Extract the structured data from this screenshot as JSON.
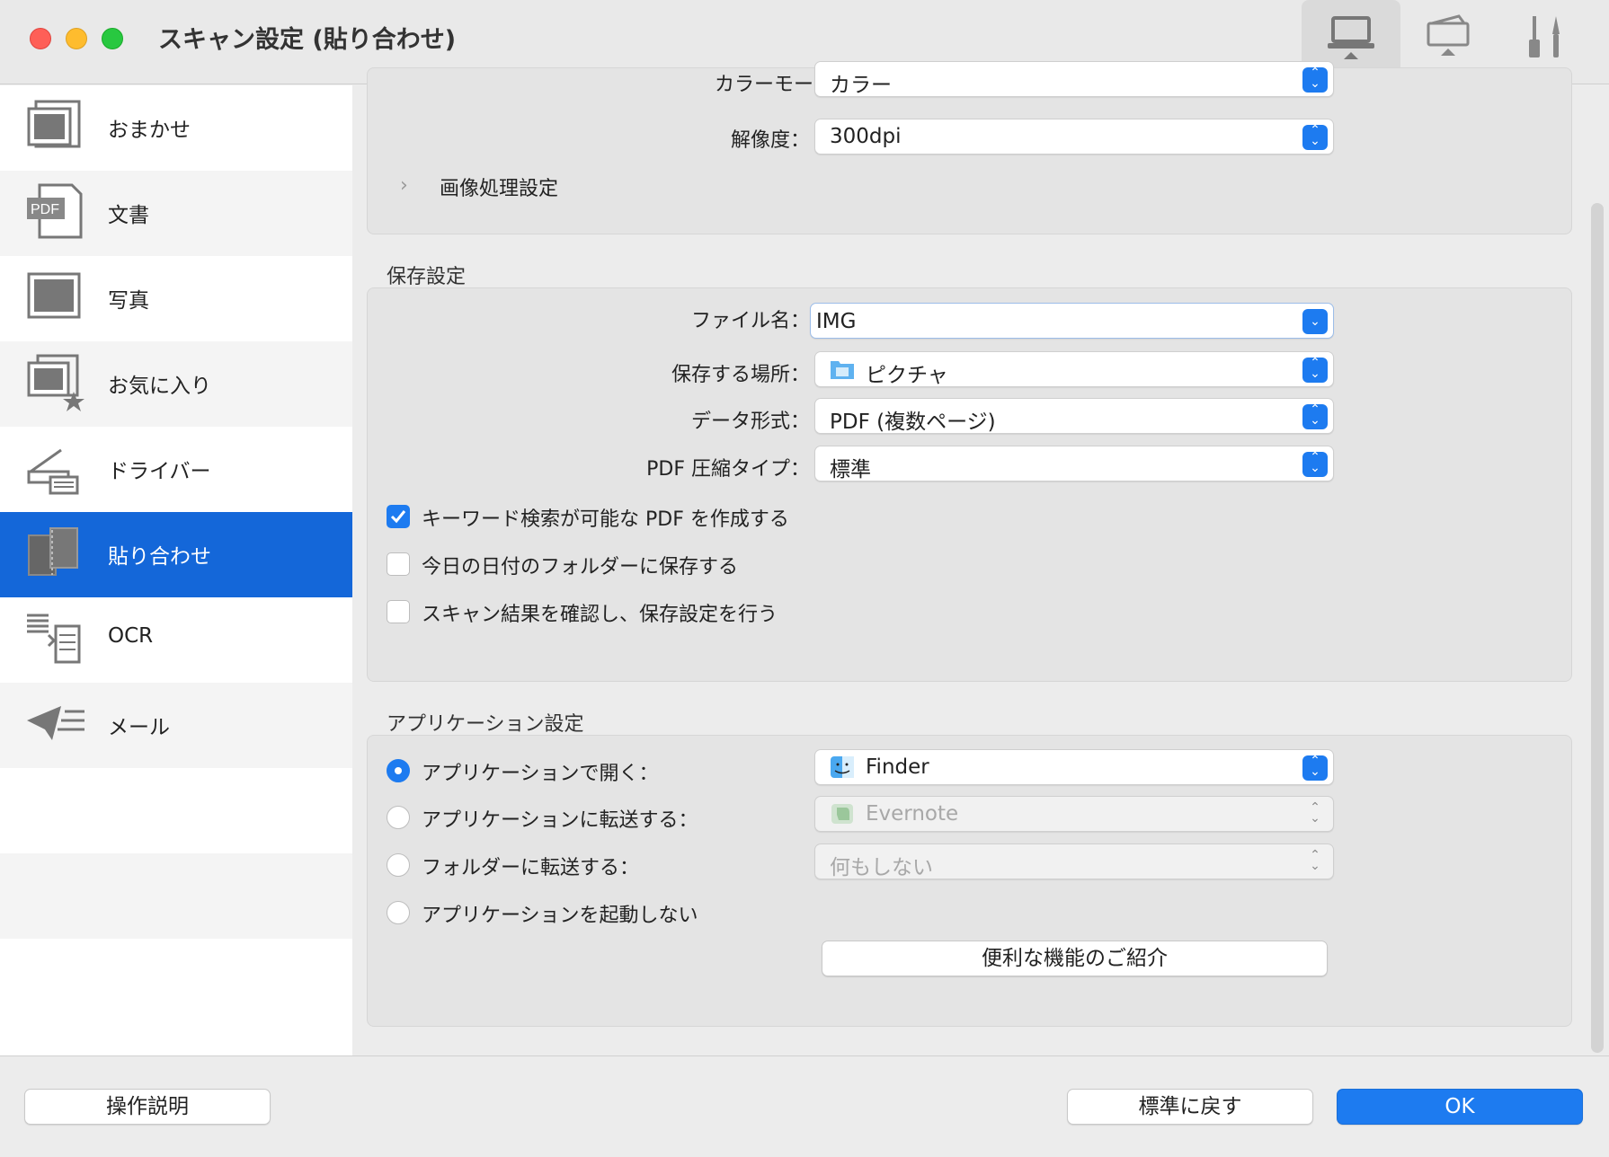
{
  "window": {
    "title": "スキャン設定 (貼り合わせ)"
  },
  "toolbar": {
    "buttons": [
      "scan-from-computer-icon",
      "scan-from-operation-panel-icon",
      "general-settings-icon"
    ]
  },
  "sidebar": {
    "items": [
      {
        "label": "おまかせ",
        "icon": "auto-scan-icon"
      },
      {
        "label": "文書",
        "icon": "pdf-document-icon"
      },
      {
        "label": "写真",
        "icon": "photo-icon"
      },
      {
        "label": "お気に入り",
        "icon": "favorite-icon"
      },
      {
        "label": "ドライバー",
        "icon": "scanner-driver-icon"
      },
      {
        "label": "貼り合わせ",
        "icon": "stitch-icon",
        "selected": true
      },
      {
        "label": "OCR",
        "icon": "ocr-icon"
      },
      {
        "label": "メール",
        "icon": "mail-icon"
      }
    ]
  },
  "scan_settings": {
    "color_mode_label": "カラーモード：",
    "color_mode_value": "カラー",
    "resolution_label": "解像度：",
    "resolution_value": "300dpi",
    "image_processing": "画像処理設定"
  },
  "save_settings": {
    "title": "保存設定",
    "file_name_label": "ファイル名：",
    "file_name_value": "IMG",
    "location_label": "保存する場所：",
    "location_value": "ピクチャ",
    "format_label": "データ形式：",
    "format_value": "PDF (複数ページ)",
    "compression_label": "PDF 圧縮タイプ：",
    "compression_value": "標準",
    "checkboxes": [
      {
        "label": "キーワード検索が可能な PDF を作成する",
        "checked": true
      },
      {
        "label": "今日の日付のフォルダーに保存する",
        "checked": false
      },
      {
        "label": "スキャン結果を確認し、保存設定を行う",
        "checked": false
      }
    ]
  },
  "app_settings": {
    "title": "アプリケーション設定",
    "options": [
      {
        "label": "アプリケーションで開く：",
        "selected": true
      },
      {
        "label": "アプリケーションに転送する：",
        "selected": false
      },
      {
        "label": "フォルダーに転送する：",
        "selected": false
      },
      {
        "label": "アプリケーションを起動しない",
        "selected": false
      }
    ],
    "open_app_value": "Finder",
    "send_app_value": "Evernote",
    "send_folder_value": "何もしない",
    "features_button": "便利な機能のご紹介"
  },
  "footer": {
    "instructions_button": "操作説明",
    "defaults_button": "標準に戻す",
    "ok_button": "OK"
  },
  "colors": {
    "accent": "#1d7bf0",
    "selection": "#1467d9"
  }
}
